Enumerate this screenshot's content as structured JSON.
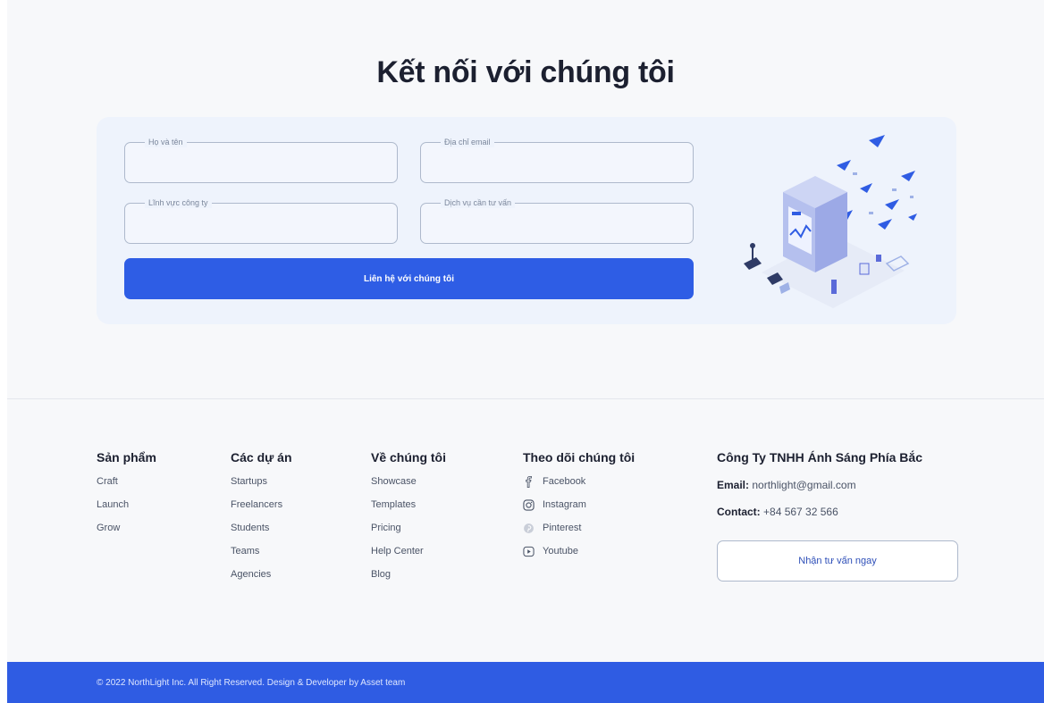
{
  "contact": {
    "title": "Kết nối với chúng tôi",
    "fields": [
      {
        "label": "Họ và tên",
        "value": ""
      },
      {
        "label": "Địa chỉ email",
        "value": ""
      },
      {
        "label": "Lĩnh vực công ty",
        "value": ""
      },
      {
        "label": "Dịch vụ cần tư vấn",
        "value": ""
      }
    ],
    "submit_label": "Liên hệ với chúng tôi"
  },
  "footer": {
    "columns": [
      {
        "title": "Sản phẩm",
        "items": [
          "Craft",
          "Launch",
          "Grow"
        ]
      },
      {
        "title": "Các dự án",
        "items": [
          "Startups",
          "Freelancers",
          "Students",
          "Teams",
          "Agencies"
        ]
      },
      {
        "title": "Về chúng tôi",
        "items": [
          "Showcase",
          "Templates",
          "Pricing",
          "Help Center",
          "Blog"
        ]
      }
    ],
    "social": {
      "title": "Theo dõi chúng tôi",
      "items": [
        {
          "label": "Facebook",
          "icon": "facebook-icon"
        },
        {
          "label": "Instagram",
          "icon": "instagram-icon"
        },
        {
          "label": "Pinterest",
          "icon": "pinterest-icon"
        },
        {
          "label": "Youtube",
          "icon": "youtube-icon"
        }
      ]
    },
    "company": {
      "name": "Công Ty TNHH Ánh Sáng Phía Bắc",
      "email_label": "Email:",
      "email": "northlight@gmail.com",
      "contact_label": "Contact:",
      "phone": "+84 567 32 566",
      "cta_label": "Nhận tư vấn ngay"
    }
  },
  "copyright": "© 2022 NorthLight Inc. All Right Reserved. Design & Developer by Asset team",
  "colors": {
    "primary": "#2e5de5",
    "card_bg": "#eef3fc",
    "page_bg": "#f7f8fa"
  }
}
